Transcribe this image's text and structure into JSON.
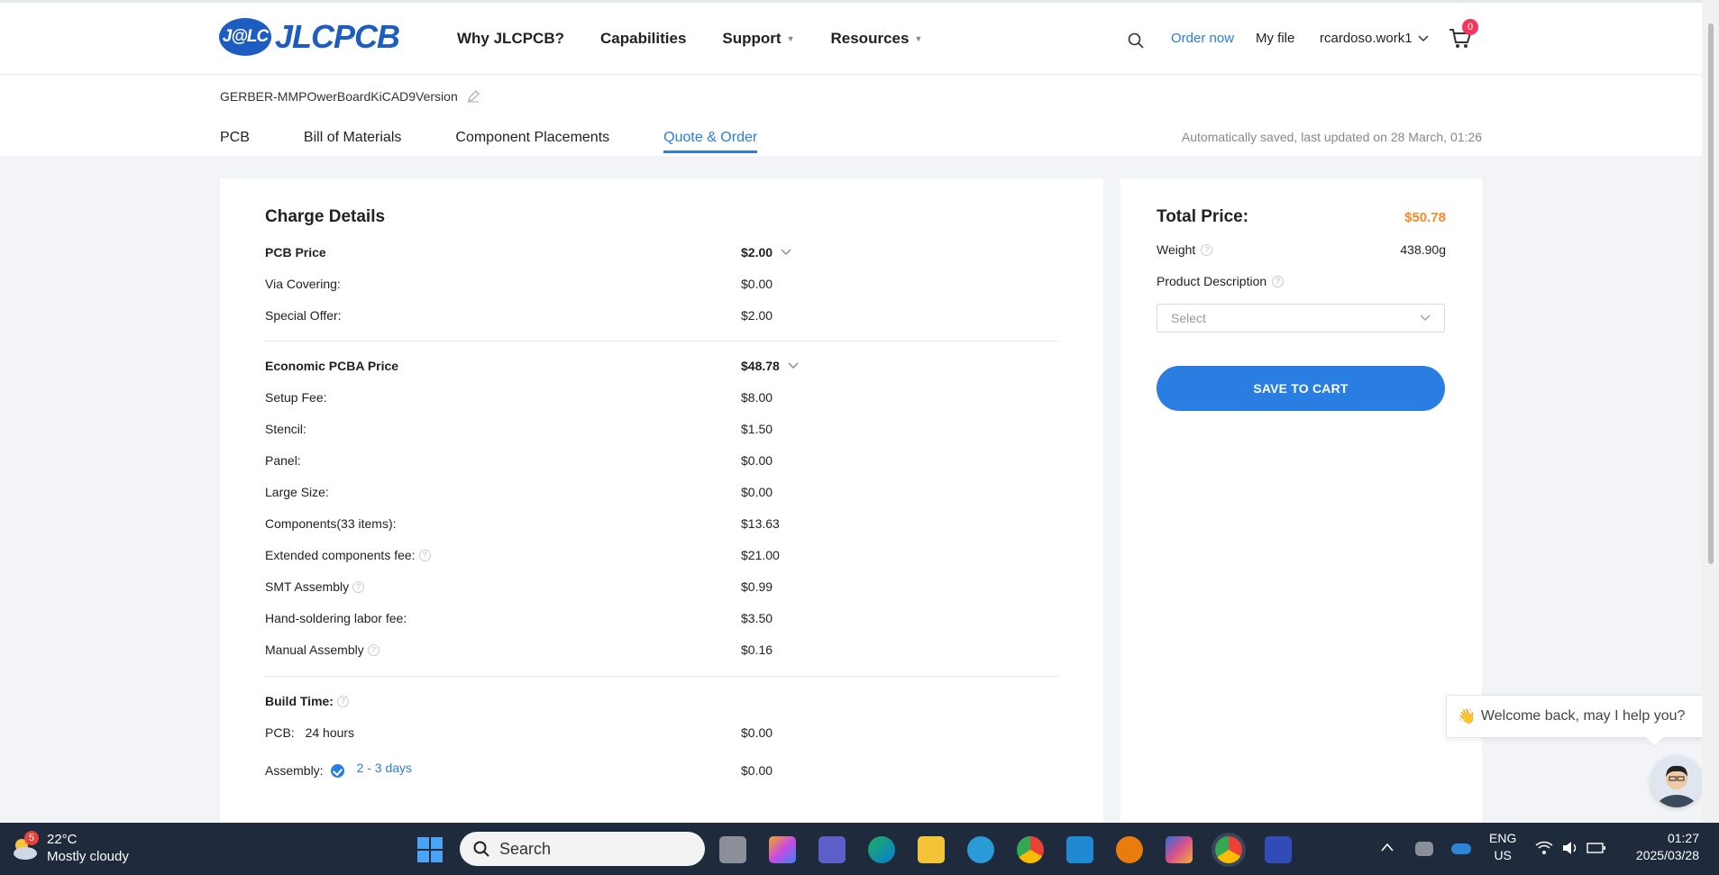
{
  "header": {
    "logo_badge": "J@LC",
    "logo_text": "JLCPCB",
    "nav": [
      {
        "label": "Why JLCPCB?",
        "caret": false
      },
      {
        "label": "Capabilities",
        "caret": false
      },
      {
        "label": "Support",
        "caret": true
      },
      {
        "label": "Resources",
        "caret": true
      }
    ],
    "order_now": "Order now",
    "my_file": "My file",
    "user": "rcardoso.work1",
    "cart_count": "0"
  },
  "project": {
    "filename": "GERBER-MMPOwerBoardKiCAD9Version",
    "tabs": [
      "PCB",
      "Bill of Materials",
      "Component Placements",
      "Quote & Order"
    ],
    "active_tab": 3,
    "autosave": "Automatically saved, last updated on 28 March, 01:26"
  },
  "charges": {
    "title": "Charge Details",
    "pcb_price": {
      "label": "PCB Price",
      "value": "$2.00"
    },
    "pcb_items": [
      {
        "label": "Via Covering:",
        "value": "$0.00"
      },
      {
        "label": "Special Offer:",
        "value": "$2.00"
      }
    ],
    "pcba_price": {
      "label": "Economic PCBA Price",
      "value": "$48.78"
    },
    "pcba_items": [
      {
        "label": "Setup Fee:",
        "value": "$8.00",
        "help": false
      },
      {
        "label": "Stencil:",
        "value": "$1.50",
        "help": false
      },
      {
        "label": "Panel:",
        "value": "$0.00",
        "help": false
      },
      {
        "label": "Large Size:",
        "value": "$0.00",
        "help": false
      },
      {
        "label": "Components(33 items):",
        "value": "$13.63",
        "help": false
      },
      {
        "label": "Extended components fee:",
        "value": "$21.00",
        "help": true
      },
      {
        "label": "SMT Assembly",
        "value": "$0.99",
        "help": true
      },
      {
        "label": "Hand-soldering labor fee:",
        "value": "$3.50",
        "help": false
      },
      {
        "label": "Manual Assembly",
        "value": "$0.16",
        "help": true
      }
    ],
    "build_time": {
      "label": "Build Time:",
      "pcb_label": "PCB:",
      "pcb_time": "24 hours",
      "pcb_value": "$0.00",
      "assembly_label": "Assembly:",
      "assembly_time": "2 - 3 days",
      "assembly_value": "$0.00"
    }
  },
  "summary": {
    "total_label": "Total Price:",
    "total_value": "$50.78",
    "weight_label": "Weight",
    "weight_value": "438.90g",
    "product_desc_label": "Product Description",
    "select_placeholder": "Select",
    "save_button": "SAVE TO CART"
  },
  "chat": {
    "emoji": "👋",
    "message": "Welcome back, may I help you?"
  },
  "taskbar": {
    "weather_badge": "5",
    "temperature": "22°C",
    "condition": "Mostly cloudy",
    "search_placeholder": "Search",
    "lang_top": "ENG",
    "lang_bottom": "US",
    "time": "01:27",
    "date": "2025/03/28"
  },
  "colors": {
    "accent": "#2a7de1",
    "total_price": "#f58a2a",
    "cart_badge": "#f5365c",
    "taskbar": "#1f2b3d"
  }
}
